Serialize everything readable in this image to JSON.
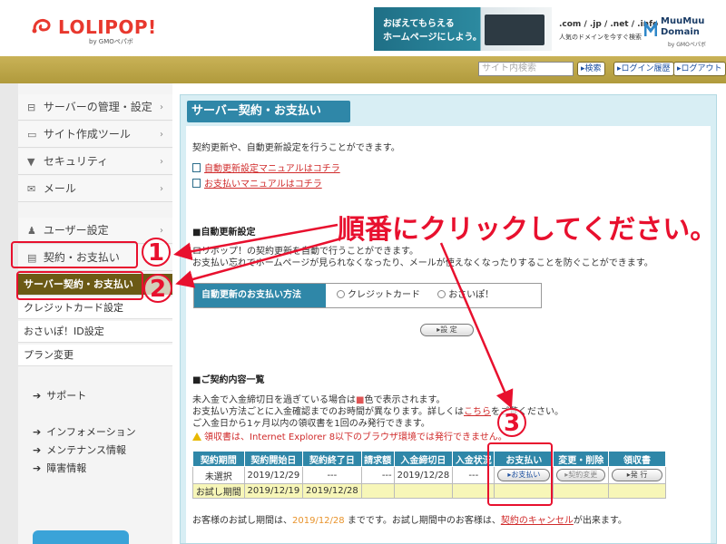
{
  "header": {
    "logo_text": "LOLIPOP!",
    "logo_sub": "by GMOペパボ",
    "banner1_line1": "おぼえてもらえる",
    "banner1_line2": "ホームページにしよう。",
    "banner2_domains": ".com / .jp / .net / .info",
    "banner2_tagline": "人気のドメインを今すぐ検索",
    "banner2_brand_line1": "MuuMuu",
    "banner2_brand_line2": "Domain",
    "banner2_brand_sub": "by GMOペパボ"
  },
  "topbar": {
    "search_placeholder": "サイト内検索",
    "search_button": "▸検索",
    "login_history": "▸ログイン履歴",
    "logout": "▸ログアウト"
  },
  "sidebar": {
    "items": [
      {
        "icon": "server-icon",
        "glyph": "⊟",
        "label": "サーバーの管理・設定"
      },
      {
        "icon": "laptop-icon",
        "glyph": "▭",
        "label": "サイト作成ツール"
      },
      {
        "icon": "shield-icon",
        "glyph": "▼",
        "label": "セキュリティ"
      },
      {
        "icon": "mail-icon",
        "glyph": "✉",
        "label": "メール"
      },
      {
        "icon": "user-icon",
        "glyph": "♟",
        "label": "ユーザー設定"
      },
      {
        "icon": "card-icon",
        "glyph": "▤",
        "label": "契約・お支払い"
      }
    ],
    "subitems": [
      {
        "label": "サーバー契約・お支払い",
        "active": true
      },
      {
        "label": "クレジットカード設定",
        "active": false
      },
      {
        "label": "おさいぽ！ID設定",
        "active": false
      },
      {
        "label": "プラン変更",
        "active": false
      }
    ],
    "links": [
      "サポート",
      "インフォメーション",
      "メンテナンス情報",
      "障害情報"
    ],
    "chevron": "›",
    "arrow": "➔"
  },
  "main": {
    "title": "サーバー契約・お支払い",
    "intro": "契約更新や、自動更新設定を行うことができます。",
    "manual_links": [
      "自動更新設定マニュアルはコチラ",
      "お支払いマニュアルはコチラ"
    ],
    "auto_renew": {
      "heading": "■自動更新設定",
      "desc1": "ロリポップ！の契約更新を自動で行うことができます。",
      "desc2": "お支払い忘れでホームページが見られなくなったり、メールが使えなくなったりすることを防ぐことができます。",
      "method_label": "自動更新のお支払い方法",
      "option_credit": "クレジットカード",
      "option_osaipo": "おさいぽ！",
      "set_button": "▸設 定"
    },
    "contract": {
      "heading": "■ご契約内容一覧",
      "note1a": "未入金で入金締切日を過ぎている場合は",
      "note1_square": "■",
      "note1b": "色で表示されます。",
      "note2a": "お支払い方法ごとに入金確認までのお時間が異なります。詳しくは",
      "note2_link": "こちら",
      "note2b": "をご覧ください。",
      "note3": "ご入金日から1ヶ月以内の領収書を1回のみ発行できます。",
      "note4": "領収書は、Internet Explorer 8以下のブラウザ環境では発行できません。",
      "columns": [
        "契約期間",
        "契約開始日",
        "契約終了日",
        "請求額",
        "入金締切日",
        "入金状況",
        "お支払い",
        "変更・削除",
        "領収書"
      ],
      "rows": [
        {
          "period": "未選択",
          "start": "2019/12/29",
          "end": "---",
          "amount": "---",
          "deadline": "2019/12/28",
          "status": "---",
          "pay": "▸お支払い",
          "change": "▸契約変更",
          "receipt": "▸発 行"
        }
      ],
      "trial_row": {
        "period": "お試し期間",
        "start": "2019/12/19",
        "end": "2019/12/28"
      }
    },
    "footer": {
      "part1": "お客様のお試し期間は、",
      "date": "2019/12/28",
      "part2": " までです。お試し期間中のお客様は、",
      "link": "契約のキャンセル",
      "part3": "が出来ます。"
    }
  },
  "annotation": {
    "instruction": "順番にクリックしてください。",
    "step1": "1",
    "step2": "2",
    "step3": "3",
    "color": "#e8102e"
  }
}
